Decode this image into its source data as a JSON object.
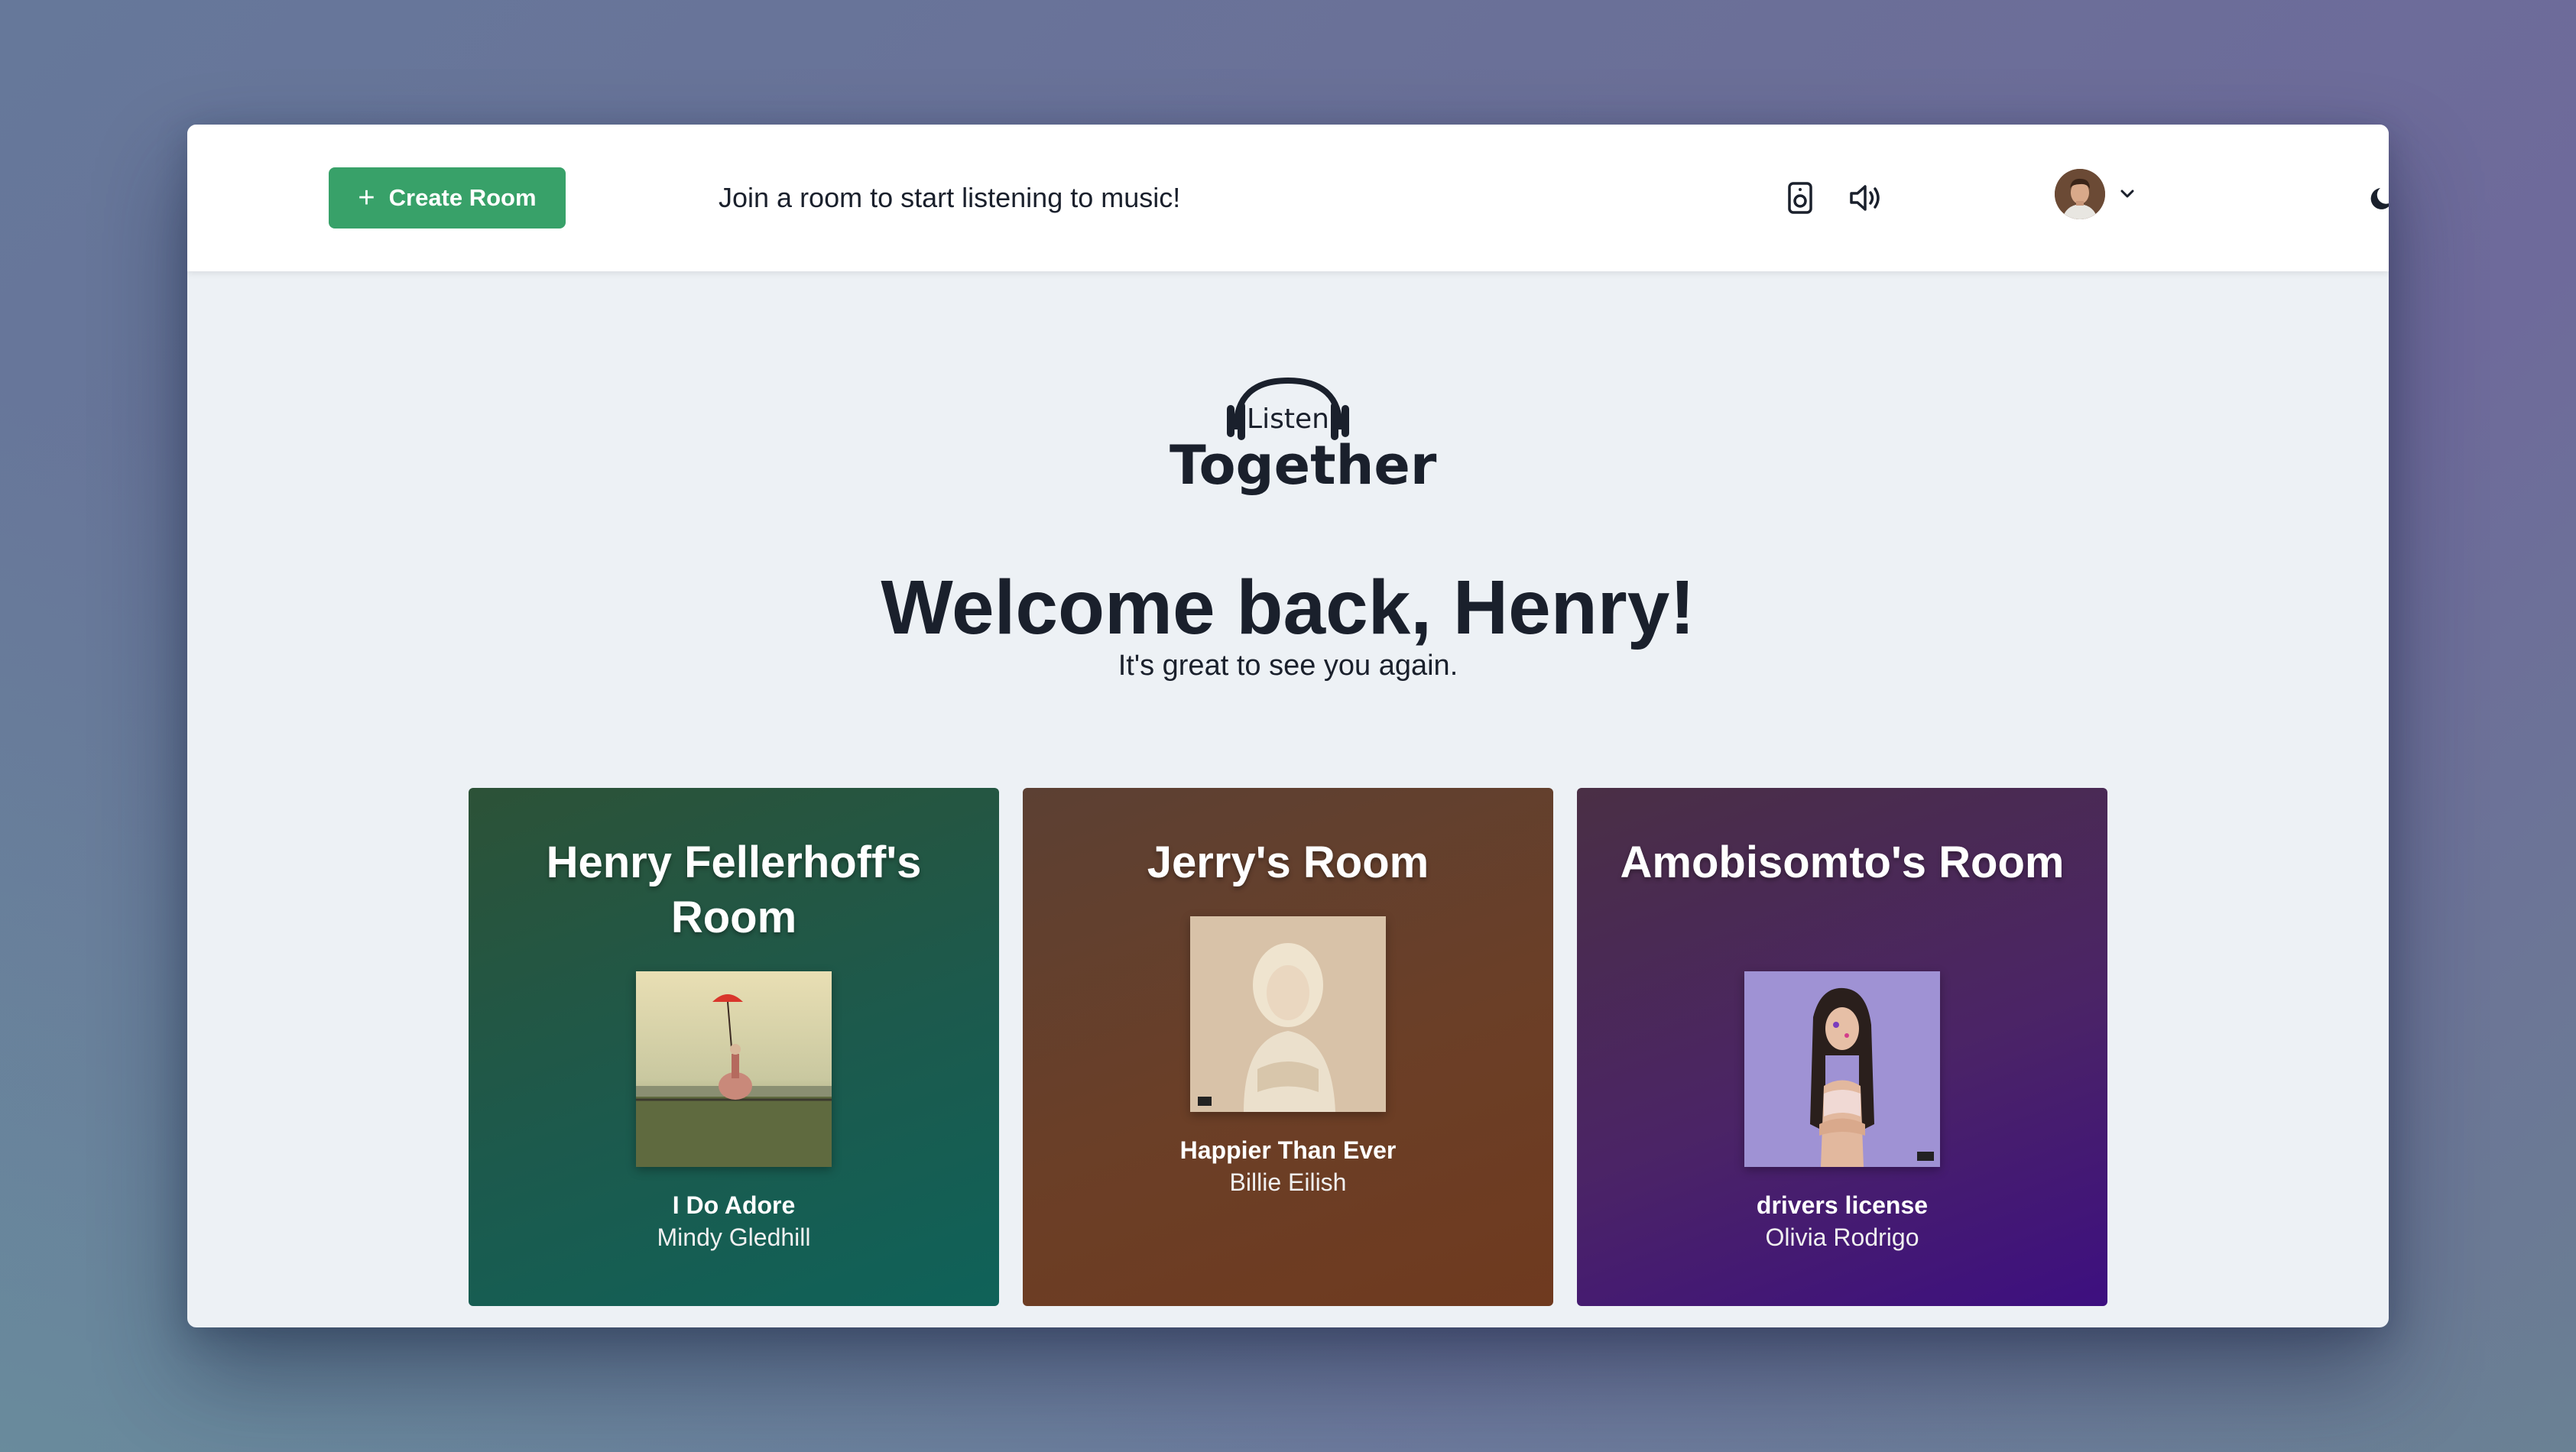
{
  "header": {
    "create_room_label": "Create Room",
    "join_message": "Join a room to start listening to music!",
    "icons": [
      "speaker-icon",
      "volume-icon",
      "chevron-down-icon",
      "moon-icon"
    ]
  },
  "logo": {
    "line1": "Listen",
    "line2": "Together"
  },
  "welcome": {
    "title": "Welcome back, Henry!",
    "subtitle": "It's great to see you again."
  },
  "rooms": [
    {
      "name": "Henry Fellerhoff's Room",
      "song": "I Do Adore",
      "artist": "Mindy Gledhill",
      "color": "#1c5a4d"
    },
    {
      "name": "Jerry's Room",
      "song": "Happier Than Ever",
      "artist": "Billie Eilish",
      "color": "#6b3f27"
    },
    {
      "name": "Amobisomto's Room",
      "song": "drivers license",
      "artist": "Olivia Rodrigo",
      "color": "#4b2466"
    }
  ],
  "colors": {
    "accent": "#38a169",
    "text": "#1a202c",
    "content_bg": "#edf1f5"
  }
}
